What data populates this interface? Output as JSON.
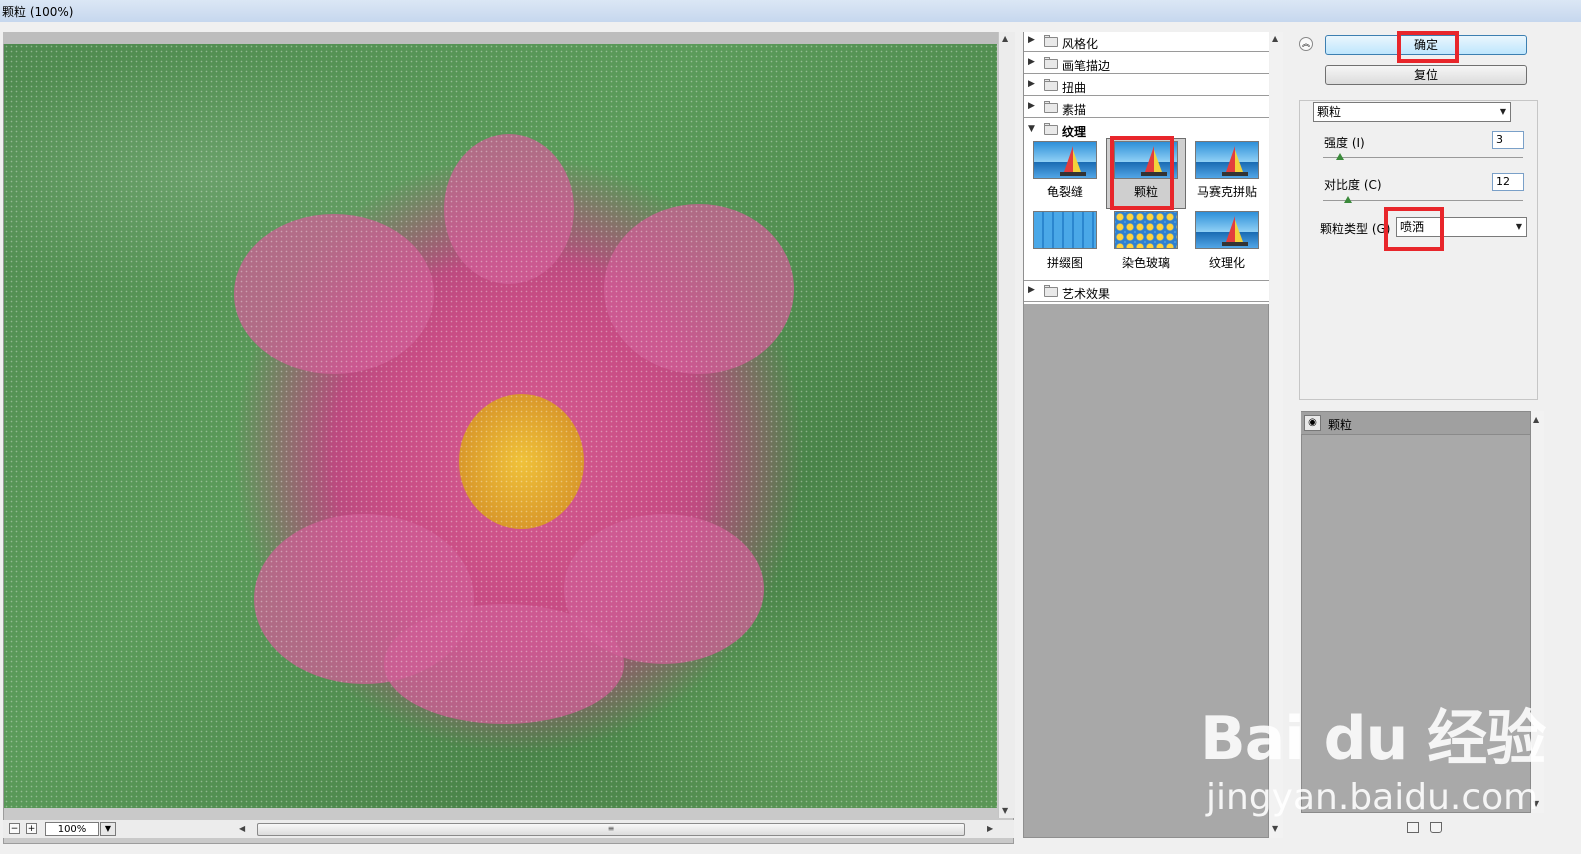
{
  "window": {
    "title": "颗粒 (100%)"
  },
  "preview": {
    "zoom_value": "100%",
    "zoom_out": "−",
    "zoom_in": "+"
  },
  "gallery": {
    "categories": [
      {
        "label": "风格化",
        "expanded": false
      },
      {
        "label": "画笔描边",
        "expanded": false
      },
      {
        "label": "扭曲",
        "expanded": false
      },
      {
        "label": "素描",
        "expanded": false
      },
      {
        "label": "纹理",
        "expanded": true
      },
      {
        "label": "艺术效果",
        "expanded": false
      }
    ],
    "texture_filters": [
      {
        "label": "龟裂缝"
      },
      {
        "label": "颗粒",
        "selected": true
      },
      {
        "label": "马赛克拼贴"
      },
      {
        "label": "拼缀图"
      },
      {
        "label": "染色玻璃"
      },
      {
        "label": "纹理化"
      }
    ]
  },
  "buttons": {
    "ok": "确定",
    "reset": "复位"
  },
  "settings": {
    "filter_select": "颗粒",
    "intensity_label": "强度 (I)",
    "intensity_value": "3",
    "contrast_label": "对比度 (C)",
    "contrast_value": "12",
    "grain_type_label": "颗粒类型 (G)",
    "grain_type_value": "喷洒"
  },
  "layers": {
    "effect_name": "颗粒"
  },
  "watermark": {
    "brand": "Bai du 经验",
    "url": "jingyan.baidu.com"
  },
  "colors": {
    "highlight_red": "#e8262b",
    "ok_button": "#bee6fd"
  }
}
